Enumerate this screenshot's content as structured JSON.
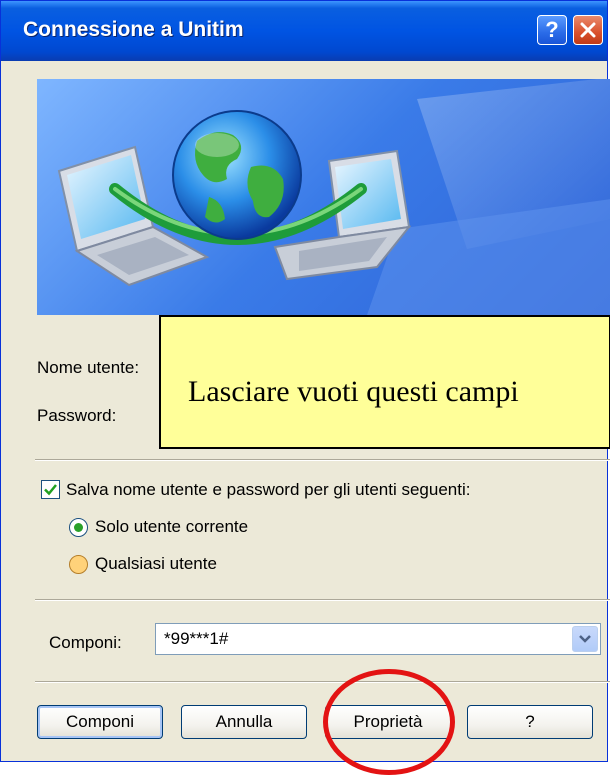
{
  "window": {
    "title": "Connessione a Unitim",
    "help_glyph": "?",
    "close_glyph": "✕"
  },
  "note": {
    "text": "Lasciare vuoti questi campi"
  },
  "form": {
    "username_label": "Nome utente:",
    "password_label": "Password:",
    "save_checkbox": {
      "label": "Salva nome utente e password per gli utenti seguenti:",
      "checked": true
    },
    "radios": [
      {
        "label": "Solo utente corrente",
        "selected": true
      },
      {
        "label": "Qualsiasi utente",
        "selected": false
      }
    ],
    "dial_label": "Componi:",
    "dial_value": "*99***1#"
  },
  "buttons": {
    "dial": "Componi",
    "cancel": "Annulla",
    "properties": "Proprietà",
    "help": "?"
  },
  "colors": {
    "titlebar": "#0054e3",
    "note_bg": "#ffff99",
    "highlight": "#e31313",
    "check": "#2aa12a"
  }
}
